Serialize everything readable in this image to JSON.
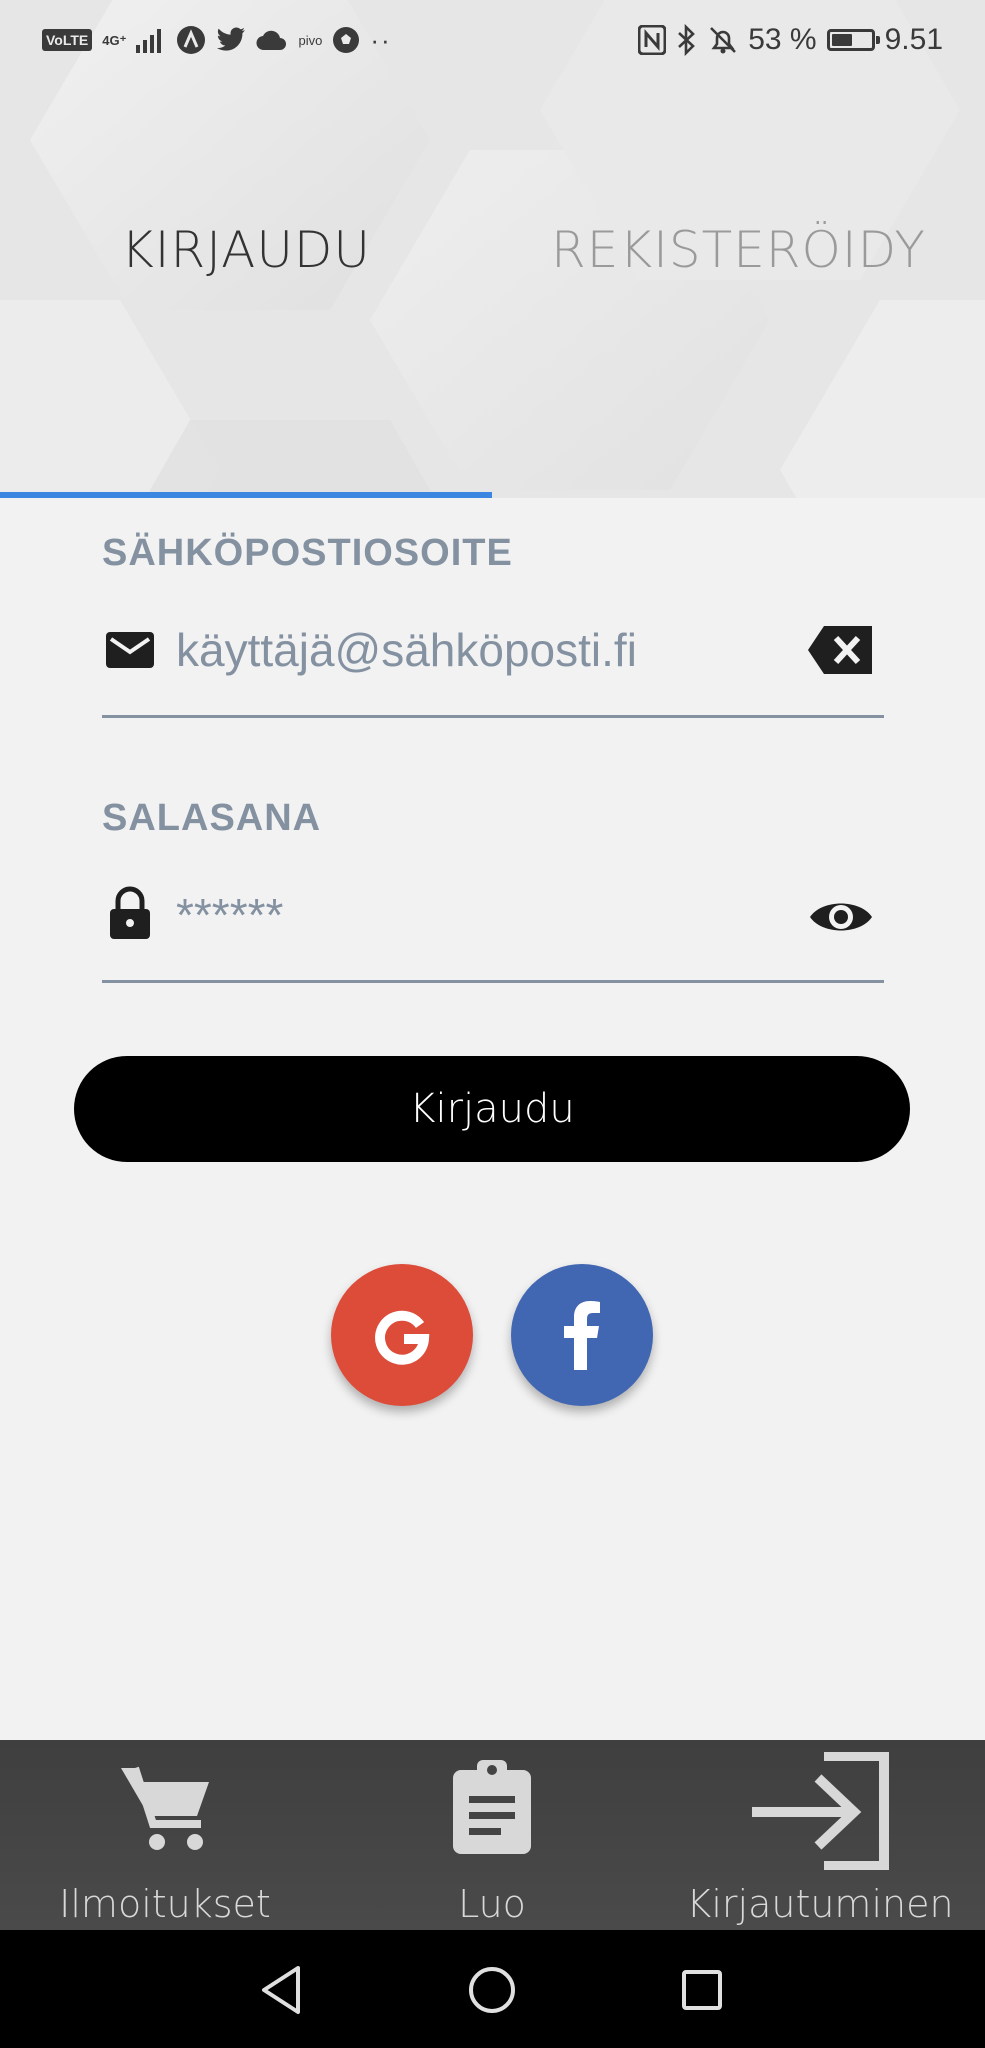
{
  "status_bar": {
    "volte": "VoLTE",
    "network": "4G⁺",
    "carrier_text": "pivo",
    "more": "··",
    "battery_percent": "53 %",
    "battery_level": 0.53,
    "time": "9.51",
    "icons_left": [
      "volte-icon",
      "signal-icon",
      "app-a-icon",
      "twitter-icon",
      "cloud-icon",
      "pivo-icon",
      "soccer-ball-icon",
      "more-icon"
    ],
    "icons_right": [
      "nfc-icon",
      "bluetooth-icon",
      "alarm-off-icon",
      "battery-icon"
    ]
  },
  "tabs": [
    {
      "label": "KIRJAUDU",
      "active": true
    },
    {
      "label": "REKISTERÖIDY",
      "active": false
    }
  ],
  "accent_color": "#3b86e0",
  "email": {
    "label": "SÄHKÖPOSTIOSOITE",
    "placeholder": "käyttäjä@sähköposti.fi",
    "icon": "mail-icon",
    "action_icon": "clear-icon"
  },
  "password": {
    "label": "SALASANA",
    "placeholder": "******",
    "icon": "lock-icon",
    "action_icon": "eye-icon"
  },
  "login_button": {
    "label": "Kirjaudu"
  },
  "social": [
    {
      "name": "google",
      "icon": "google-icon",
      "color": "#dd4b39"
    },
    {
      "name": "facebook",
      "icon": "facebook-icon",
      "color": "#4267b2"
    }
  ],
  "bottom_nav": [
    {
      "label": "Ilmoitukset",
      "icon": "cart-icon"
    },
    {
      "label": "Luo",
      "icon": "clipboard-icon"
    },
    {
      "label": "Kirjautuminen",
      "icon": "login-icon"
    }
  ],
  "system_nav": [
    "back-icon",
    "home-icon",
    "recents-icon"
  ]
}
